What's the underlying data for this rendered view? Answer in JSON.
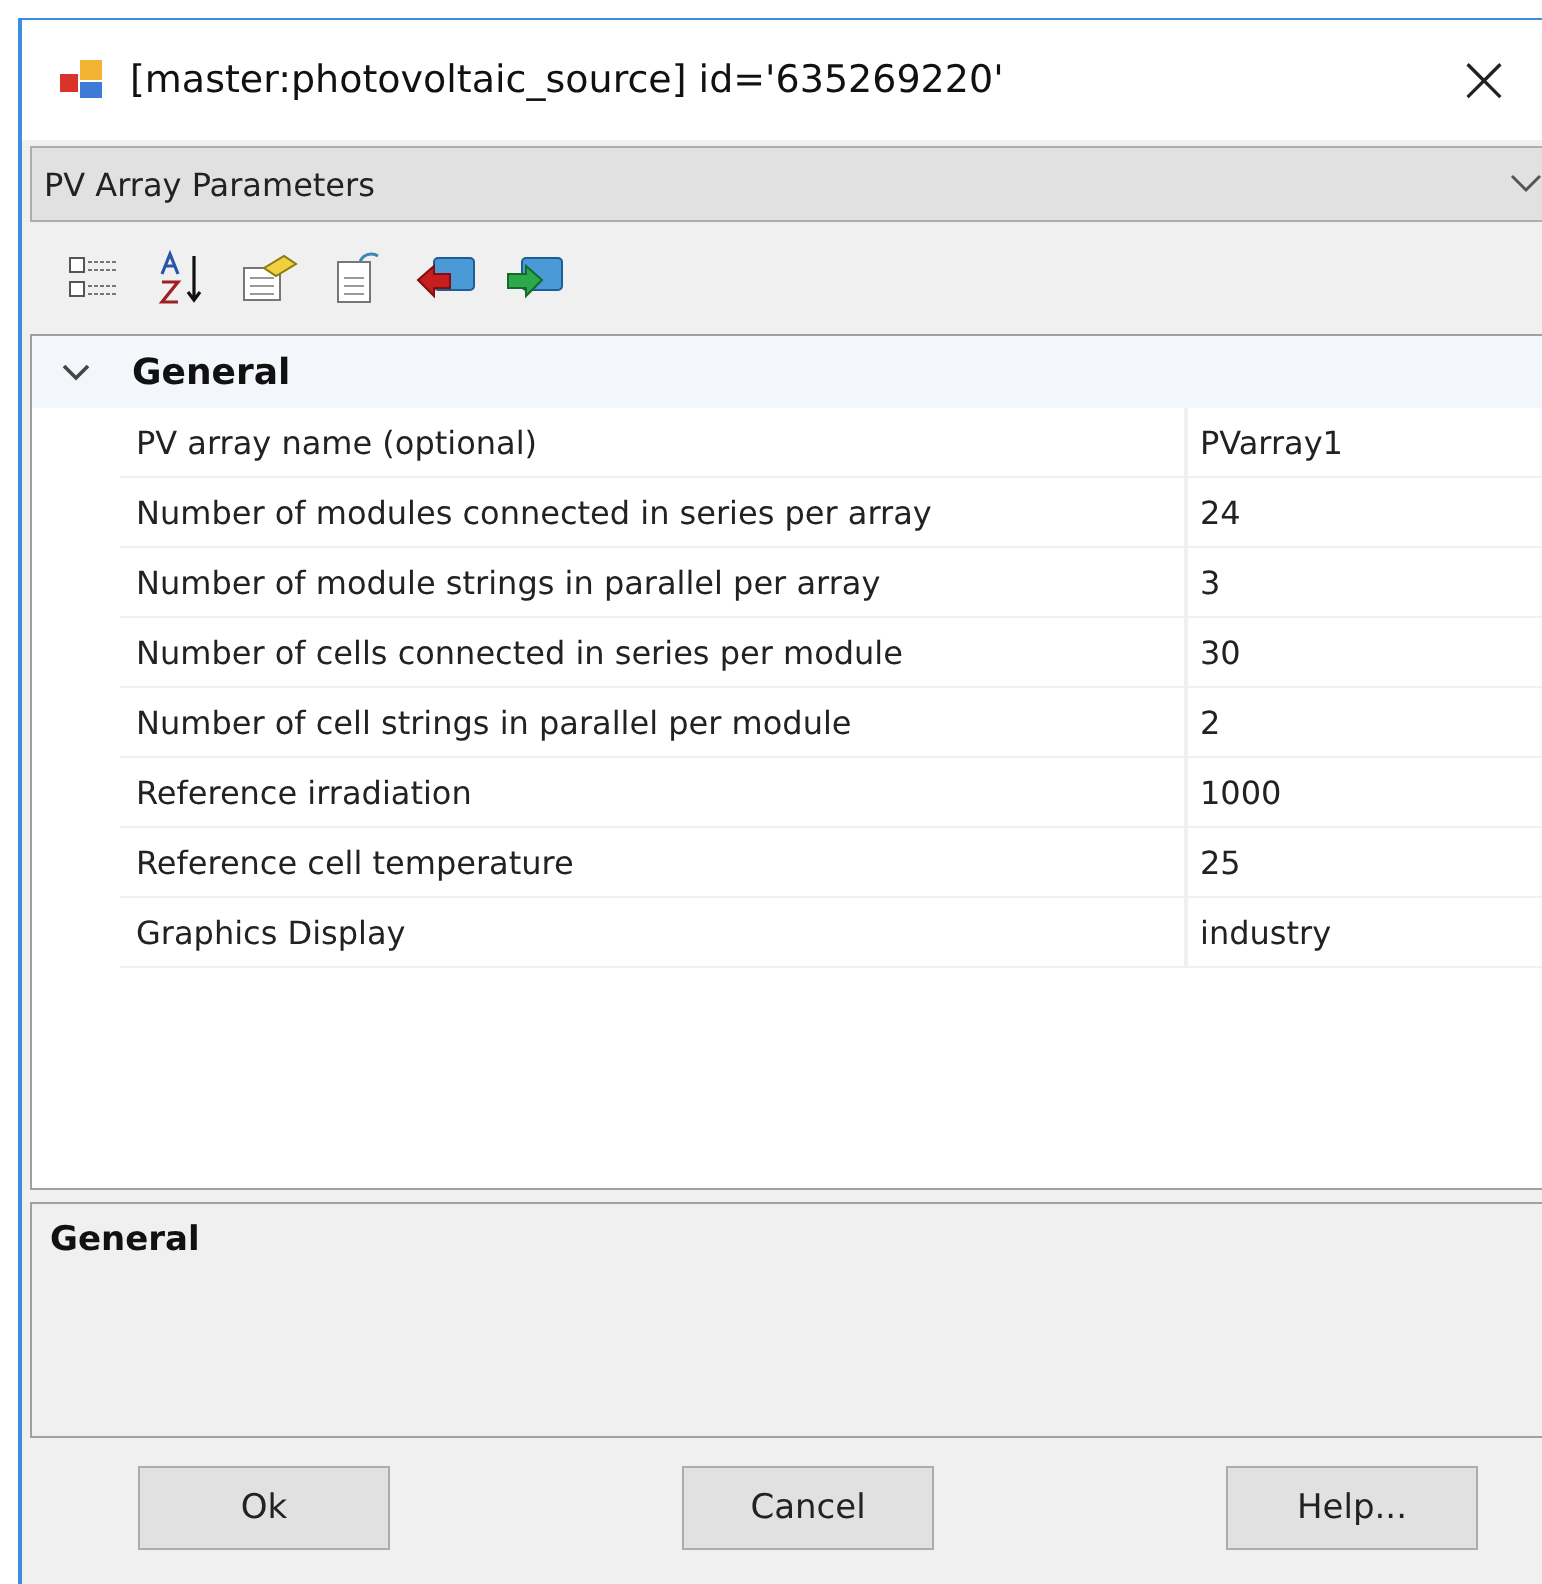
{
  "window": {
    "title": "[master:photovoltaic_source] id='635269220'",
    "close": "×"
  },
  "category_select": {
    "value": "PV Array Parameters"
  },
  "toolbar": [
    {
      "kind": "categorized"
    },
    {
      "kind": "alphabetical"
    },
    {
      "kind": "properties"
    },
    {
      "kind": "pages"
    },
    {
      "kind": "back"
    },
    {
      "kind": "forward"
    }
  ],
  "grid": {
    "groups": [
      {
        "title": "General",
        "expanded": true,
        "rows": [
          {
            "label": "PV array name (optional)",
            "value": "PVarray1"
          },
          {
            "label": "Number of modules connected in series per array",
            "value": "24"
          },
          {
            "label": "Number of module strings in parallel per array",
            "value": "3"
          },
          {
            "label": "Number of cells connected in series per module",
            "value": "30"
          },
          {
            "label": "Number of cell strings in parallel per module",
            "value": "2"
          },
          {
            "label": "Reference irradiation",
            "value": "1000"
          },
          {
            "label": "Reference cell temperature",
            "value": "25"
          },
          {
            "label": "Graphics Display",
            "value": "industry"
          }
        ]
      }
    ]
  },
  "description": {
    "title": "General"
  },
  "buttons": [
    "Ok",
    "Cancel",
    "Help..."
  ]
}
